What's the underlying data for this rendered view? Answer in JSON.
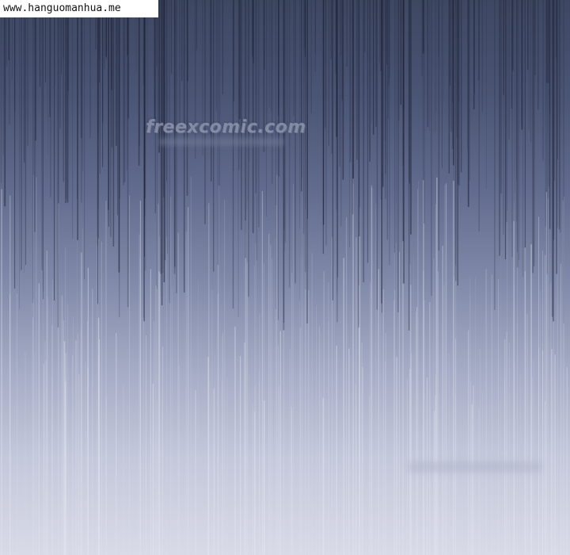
{
  "source_badge": {
    "text": "www.hanguomanhua.me"
  },
  "watermark": {
    "text": "freexcomic.com"
  },
  "palette": {
    "sky_top": "#3e4762",
    "sky_mid": "#7f88a8",
    "sky_bottom": "#d8dae7",
    "streak_dark": "#1e2236",
    "streak_light": "#e6e8f2"
  }
}
